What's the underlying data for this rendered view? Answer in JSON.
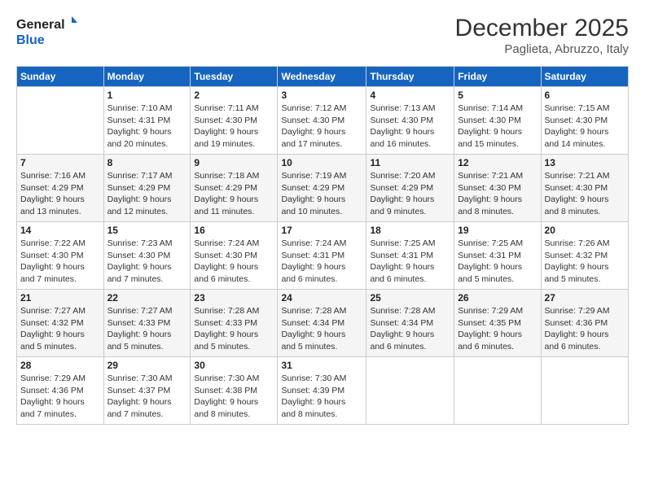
{
  "logo": {
    "line1": "General",
    "line2": "Blue"
  },
  "title": "December 2025",
  "location": "Paglieta, Abruzzo, Italy",
  "days_header": [
    "Sunday",
    "Monday",
    "Tuesday",
    "Wednesday",
    "Thursday",
    "Friday",
    "Saturday"
  ],
  "weeks": [
    [
      {
        "day": "",
        "info": ""
      },
      {
        "day": "1",
        "info": "Sunrise: 7:10 AM\nSunset: 4:31 PM\nDaylight: 9 hours\nand 20 minutes."
      },
      {
        "day": "2",
        "info": "Sunrise: 7:11 AM\nSunset: 4:30 PM\nDaylight: 9 hours\nand 19 minutes."
      },
      {
        "day": "3",
        "info": "Sunrise: 7:12 AM\nSunset: 4:30 PM\nDaylight: 9 hours\nand 17 minutes."
      },
      {
        "day": "4",
        "info": "Sunrise: 7:13 AM\nSunset: 4:30 PM\nDaylight: 9 hours\nand 16 minutes."
      },
      {
        "day": "5",
        "info": "Sunrise: 7:14 AM\nSunset: 4:30 PM\nDaylight: 9 hours\nand 15 minutes."
      },
      {
        "day": "6",
        "info": "Sunrise: 7:15 AM\nSunset: 4:30 PM\nDaylight: 9 hours\nand 14 minutes."
      }
    ],
    [
      {
        "day": "7",
        "info": "Sunrise: 7:16 AM\nSunset: 4:29 PM\nDaylight: 9 hours\nand 13 minutes."
      },
      {
        "day": "8",
        "info": "Sunrise: 7:17 AM\nSunset: 4:29 PM\nDaylight: 9 hours\nand 12 minutes."
      },
      {
        "day": "9",
        "info": "Sunrise: 7:18 AM\nSunset: 4:29 PM\nDaylight: 9 hours\nand 11 minutes."
      },
      {
        "day": "10",
        "info": "Sunrise: 7:19 AM\nSunset: 4:29 PM\nDaylight: 9 hours\nand 10 minutes."
      },
      {
        "day": "11",
        "info": "Sunrise: 7:20 AM\nSunset: 4:29 PM\nDaylight: 9 hours\nand 9 minutes."
      },
      {
        "day": "12",
        "info": "Sunrise: 7:21 AM\nSunset: 4:30 PM\nDaylight: 9 hours\nand 8 minutes."
      },
      {
        "day": "13",
        "info": "Sunrise: 7:21 AM\nSunset: 4:30 PM\nDaylight: 9 hours\nand 8 minutes."
      }
    ],
    [
      {
        "day": "14",
        "info": "Sunrise: 7:22 AM\nSunset: 4:30 PM\nDaylight: 9 hours\nand 7 minutes."
      },
      {
        "day": "15",
        "info": "Sunrise: 7:23 AM\nSunset: 4:30 PM\nDaylight: 9 hours\nand 7 minutes."
      },
      {
        "day": "16",
        "info": "Sunrise: 7:24 AM\nSunset: 4:30 PM\nDaylight: 9 hours\nand 6 minutes."
      },
      {
        "day": "17",
        "info": "Sunrise: 7:24 AM\nSunset: 4:31 PM\nDaylight: 9 hours\nand 6 minutes."
      },
      {
        "day": "18",
        "info": "Sunrise: 7:25 AM\nSunset: 4:31 PM\nDaylight: 9 hours\nand 6 minutes."
      },
      {
        "day": "19",
        "info": "Sunrise: 7:25 AM\nSunset: 4:31 PM\nDaylight: 9 hours\nand 5 minutes."
      },
      {
        "day": "20",
        "info": "Sunrise: 7:26 AM\nSunset: 4:32 PM\nDaylight: 9 hours\nand 5 minutes."
      }
    ],
    [
      {
        "day": "21",
        "info": "Sunrise: 7:27 AM\nSunset: 4:32 PM\nDaylight: 9 hours\nand 5 minutes."
      },
      {
        "day": "22",
        "info": "Sunrise: 7:27 AM\nSunset: 4:33 PM\nDaylight: 9 hours\nand 5 minutes."
      },
      {
        "day": "23",
        "info": "Sunrise: 7:28 AM\nSunset: 4:33 PM\nDaylight: 9 hours\nand 5 minutes."
      },
      {
        "day": "24",
        "info": "Sunrise: 7:28 AM\nSunset: 4:34 PM\nDaylight: 9 hours\nand 5 minutes."
      },
      {
        "day": "25",
        "info": "Sunrise: 7:28 AM\nSunset: 4:34 PM\nDaylight: 9 hours\nand 6 minutes."
      },
      {
        "day": "26",
        "info": "Sunrise: 7:29 AM\nSunset: 4:35 PM\nDaylight: 9 hours\nand 6 minutes."
      },
      {
        "day": "27",
        "info": "Sunrise: 7:29 AM\nSunset: 4:36 PM\nDaylight: 9 hours\nand 6 minutes."
      }
    ],
    [
      {
        "day": "28",
        "info": "Sunrise: 7:29 AM\nSunset: 4:36 PM\nDaylight: 9 hours\nand 7 minutes."
      },
      {
        "day": "29",
        "info": "Sunrise: 7:30 AM\nSunset: 4:37 PM\nDaylight: 9 hours\nand 7 minutes."
      },
      {
        "day": "30",
        "info": "Sunrise: 7:30 AM\nSunset: 4:38 PM\nDaylight: 9 hours\nand 8 minutes."
      },
      {
        "day": "31",
        "info": "Sunrise: 7:30 AM\nSunset: 4:39 PM\nDaylight: 9 hours\nand 8 minutes."
      },
      {
        "day": "",
        "info": ""
      },
      {
        "day": "",
        "info": ""
      },
      {
        "day": "",
        "info": ""
      }
    ]
  ]
}
